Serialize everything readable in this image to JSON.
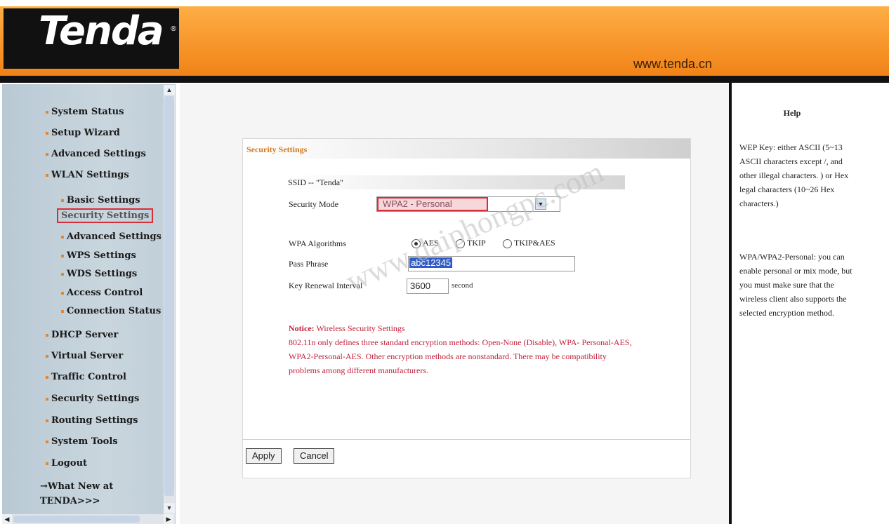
{
  "header": {
    "logo": "Tenda",
    "url": "www.tenda.cn"
  },
  "sidebar": {
    "items": [
      "System Status",
      "Setup Wizard",
      "Advanced Settings",
      "WLAN Settings"
    ],
    "wlan_sub": [
      "Basic Settings",
      "Security Settings",
      "Advanced Settings",
      "WPS Settings",
      "WDS Settings",
      "Access Control",
      "Connection Status"
    ],
    "items2": [
      "DHCP Server",
      "Virtual Server",
      "Traffic Control",
      "Security Settings",
      "Routing Settings",
      "System Tools",
      "Logout"
    ],
    "whatsnew": "→What New at",
    "whatsnew2": "TENDA>>>"
  },
  "panel": {
    "title": "Security Settings",
    "ssid": "SSID -- \"Tenda\"",
    "security_mode_label": "Security Mode",
    "security_mode_value": "WPA2 - Personal",
    "wpa_alg_label": "WPA Algorithms",
    "alg_options": [
      "AES",
      "TKIP",
      "TKIP&AES"
    ],
    "alg_selected": "AES",
    "passphrase_label": "Pass Phrase",
    "passphrase_value": "abc12345",
    "renew_label": "Key Renewal Interval",
    "renew_value": "3600",
    "renew_unit": "second",
    "notice_label": "Notice:",
    "notice_title": " Wireless Security Settings",
    "notice_body": "802.11n only defines three standard encryption methods: Open-None (Disable), WPA- Personal-AES, WPA2-Personal-AES. Other encryption methods are nonstandard. There may be compatibility problems among different manufacturers.",
    "apply": "Apply",
    "cancel": "Cancel"
  },
  "help": {
    "title": "Help",
    "text1": "WEP Key: either ASCII (5~13 ASCII characters except /, and other illegal characters. ) or Hex legal characters (10~26 Hex characters.)",
    "text2": "WPA/WPA2-Personal: you can enable personal or mix mode, but you must make sure that the wireless client also supports the selected encryption method."
  },
  "watermark": "www.daiphongpc.com",
  "colors": {
    "accent_orange": "#f7952a",
    "highlight_red": "#d62f3a",
    "notice_red": "#c3203a"
  }
}
